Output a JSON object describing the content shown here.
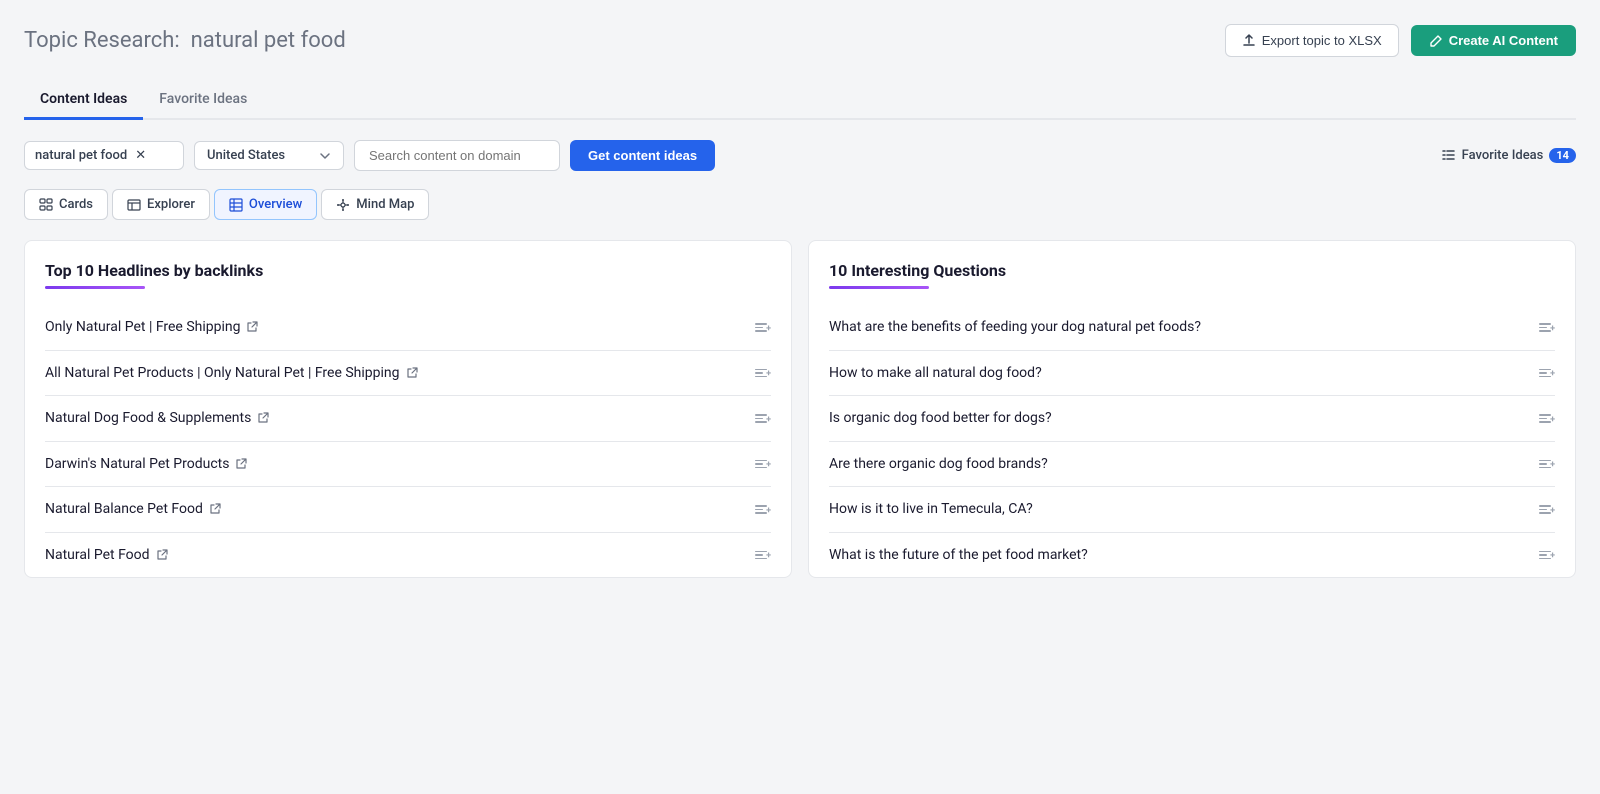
{
  "header": {
    "title_prefix": "Topic Research:",
    "title_keyword": "natural pet food",
    "btn_export_label": "Export topic to XLSX",
    "btn_create_label": "Create AI Content"
  },
  "main_tabs": [
    {
      "id": "content-ideas",
      "label": "Content Ideas",
      "active": true
    },
    {
      "id": "favorite-ideas",
      "label": "Favorite Ideas",
      "active": false
    }
  ],
  "controls": {
    "keyword_value": "natural pet food",
    "country_value": "United States",
    "domain_placeholder": "Search content on domain",
    "get_ideas_label": "Get content ideas",
    "favorite_ideas_label": "Favorite Ideas",
    "favorite_ideas_count": "14"
  },
  "view_tabs": [
    {
      "id": "cards",
      "label": "Cards",
      "icon": "cards-icon",
      "active": false
    },
    {
      "id": "explorer",
      "label": "Explorer",
      "icon": "explorer-icon",
      "active": false
    },
    {
      "id": "overview",
      "label": "Overview",
      "icon": "overview-icon",
      "active": true
    },
    {
      "id": "mind-map",
      "label": "Mind Map",
      "icon": "mindmap-icon",
      "active": false
    }
  ],
  "panels": {
    "headlines": {
      "title": "Top 10 Headlines by backlinks",
      "items": [
        {
          "text": "Only Natural Pet | Free Shipping"
        },
        {
          "text": "All Natural Pet Products | Only Natural Pet | Free Shipping"
        },
        {
          "text": "Natural Dog Food & Supplements"
        },
        {
          "text": "Darwin's Natural Pet Products"
        },
        {
          "text": "Natural Balance Pet Food"
        },
        {
          "text": "Natural Pet Food"
        }
      ]
    },
    "questions": {
      "title": "10 Interesting Questions",
      "items": [
        {
          "text": "What are the benefits of feeding your dog natural pet foods?"
        },
        {
          "text": "How to make all natural dog food?"
        },
        {
          "text": "Is organic dog food better for dogs?"
        },
        {
          "text": "Are there organic dog food brands?"
        },
        {
          "text": "How is it to live in Temecula, CA?"
        },
        {
          "text": "What is the future of the pet food market?"
        }
      ]
    }
  }
}
